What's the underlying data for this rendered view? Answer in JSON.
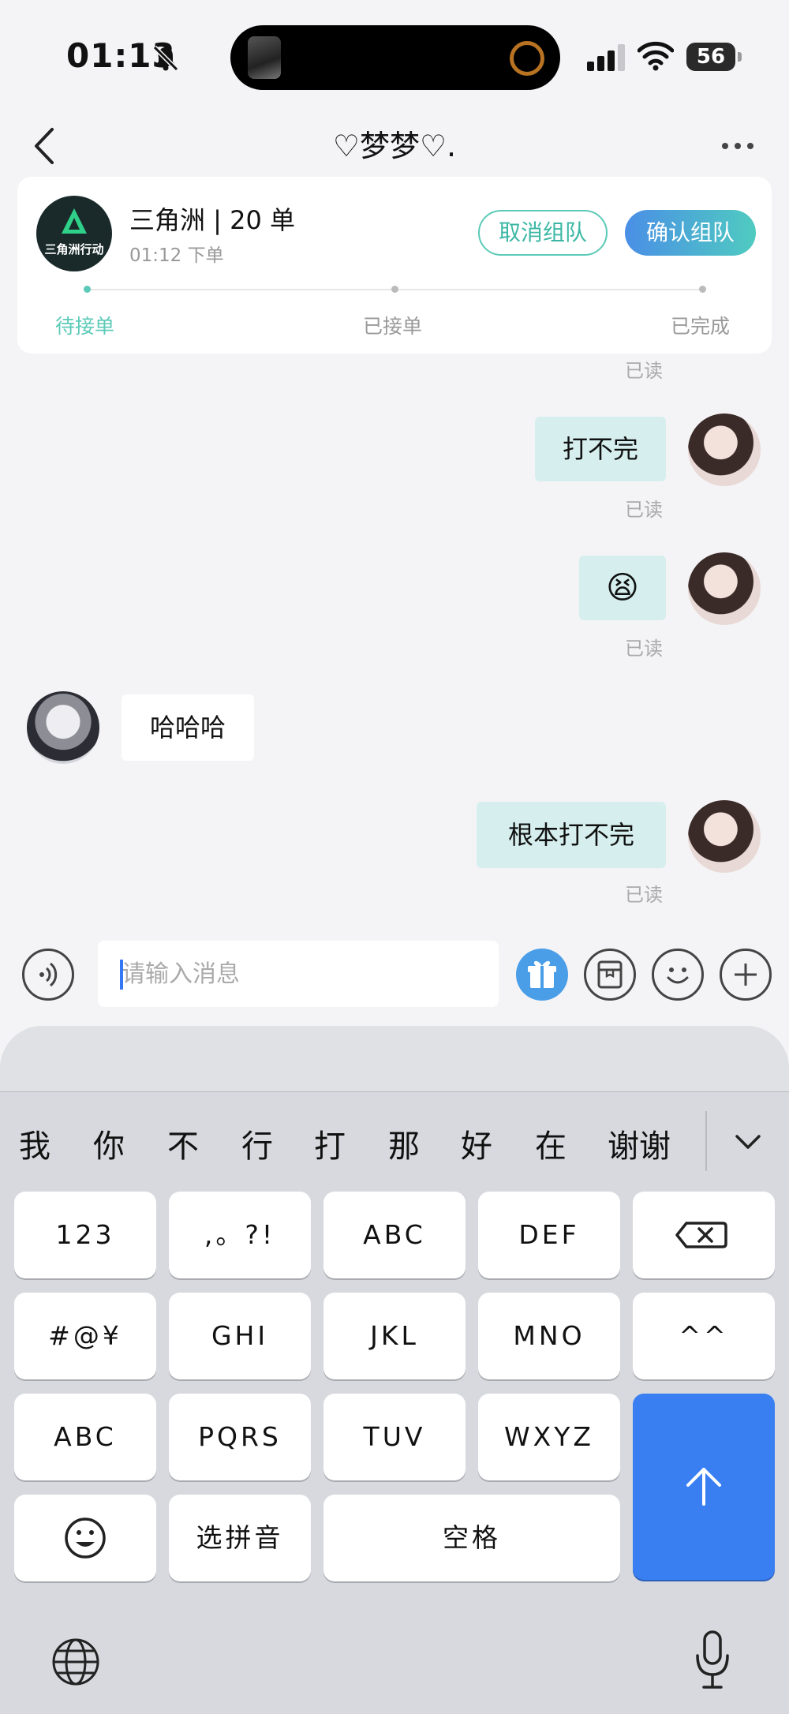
{
  "status_bar": {
    "time": "01:13",
    "battery": "56"
  },
  "nav": {
    "title": "♡梦梦♡."
  },
  "order": {
    "logo_text": "三角洲行动",
    "title": "三角洲 | 20 单",
    "time": "01:12 下单",
    "cancel_label": "取消组队",
    "confirm_label": "确认组队",
    "steps": [
      "待接单",
      "已接单",
      "已完成"
    ],
    "accent_color": "#3bb7a4"
  },
  "messages": {
    "read_top": "已读",
    "msg1": "打不完",
    "read1": "已读",
    "msg2": "😫",
    "read2": "已读",
    "msg3": "哈哈哈",
    "msg4": "根本打不完",
    "read4": "已读"
  },
  "input": {
    "placeholder": "请输入消息"
  },
  "keyboard": {
    "candidates": [
      "我",
      "你",
      "不",
      "行",
      "打",
      "那",
      "好",
      "在",
      "谢谢"
    ],
    "row1": [
      "123",
      ",。?!",
      "ABC",
      "DEF"
    ],
    "row2": [
      "#@¥",
      "GHI",
      "JKL",
      "MNO",
      "^^"
    ],
    "row3": [
      "ABC",
      "PQRS",
      "TUV",
      "WXYZ"
    ],
    "row4_pinyin": "选拼音",
    "row4_space": "空格",
    "send_color": "#3a7ff2"
  }
}
